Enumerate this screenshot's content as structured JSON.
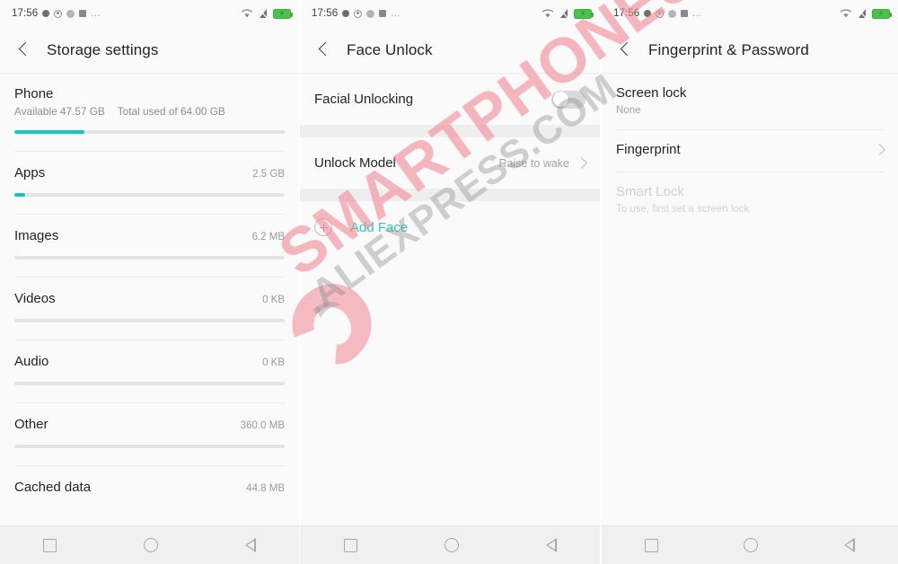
{
  "status_bar": {
    "time": "17:56",
    "left_icons": [
      "dot-solid-icon",
      "check-circle-icon",
      "circle-gray-icon",
      "square-gray-icon"
    ],
    "ellipsis": "...",
    "right_icons": [
      "wifi-icon",
      "signal-off-icon",
      "battery-charging-icon"
    ]
  },
  "nav_bar": {
    "recents_label": "recents-square-icon",
    "home_label": "home-circle-icon",
    "back_label": "back-triangle-icon"
  },
  "panels": {
    "storage": {
      "title": "Storage settings",
      "back_icon": "back-chevron-icon",
      "rows": [
        {
          "name": "Phone",
          "available_label": "Available 47.57 GB",
          "total_label": "Total used of 64.00 GB",
          "bar_percent": 26,
          "size": ""
        },
        {
          "name": "Apps",
          "size": "2.5 GB",
          "bar_percent": 4
        },
        {
          "name": "Images",
          "size": "6.2 MB",
          "bar_percent": 0
        },
        {
          "name": "Videos",
          "size": "0 KB",
          "bar_percent": 0
        },
        {
          "name": "Audio",
          "size": "0 KB",
          "bar_percent": 0
        },
        {
          "name": "Other",
          "size": "360.0 MB",
          "bar_percent": 0
        },
        {
          "name": "Cached data",
          "size": "44.8 MB",
          "bar_percent": 0
        }
      ]
    },
    "face_unlock": {
      "title": "Face Unlock",
      "back_icon": "back-chevron-icon",
      "facial_unlocking_label": "Facial Unlocking",
      "facial_unlocking_state": "off",
      "unlock_model_label": "Unlock Model",
      "unlock_model_value": "Raise to wake",
      "add_face_label": "Add Face",
      "add_face_icon": "plus-circle-icon",
      "accent_color": "#2fc9c1"
    },
    "fingerprint": {
      "title": "Fingerprint & Password",
      "back_icon": "back-chevron-icon",
      "screen_lock_label": "Screen lock",
      "screen_lock_value": "None",
      "fingerprint_label": "Fingerprint",
      "smart_lock_label": "Smart Lock",
      "smart_lock_sub": "To use, first set a screen lock"
    }
  },
  "watermark": {
    "main": "SMARTPHONES",
    "sub": ".ALIEXPRESS.COM",
    "main_color": "#f08c96",
    "sub_color": "#8c8c8c"
  }
}
